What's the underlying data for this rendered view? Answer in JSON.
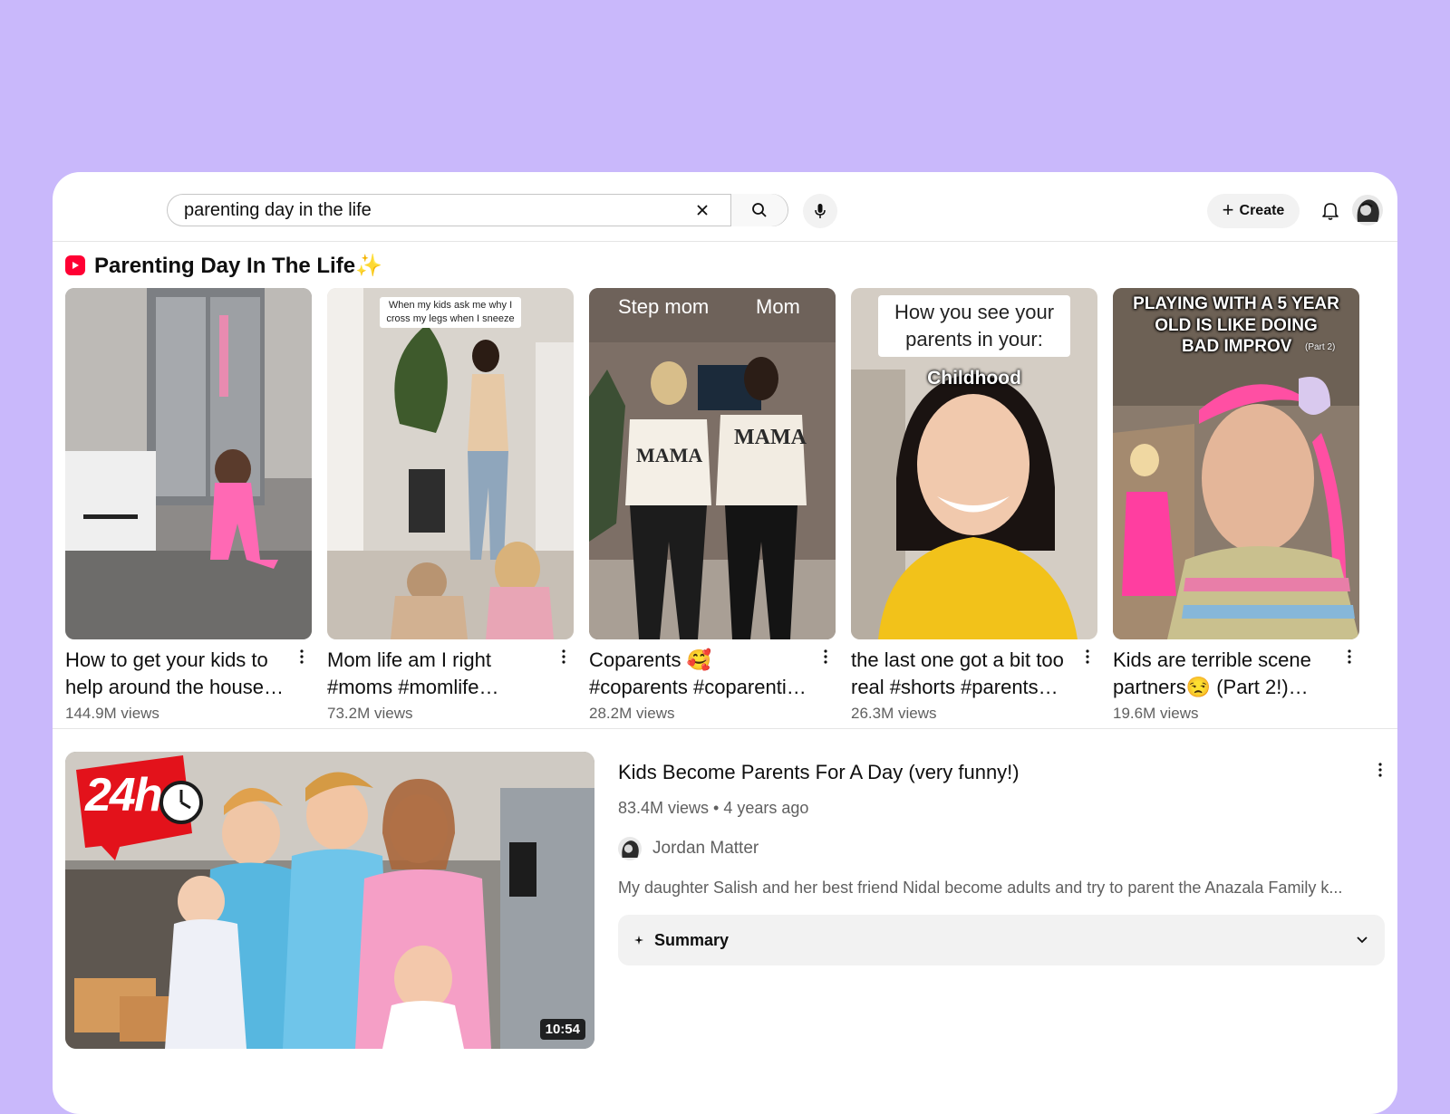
{
  "search": {
    "query": "parenting day in the life"
  },
  "header": {
    "create_label": "Create"
  },
  "shelf": {
    "title": "Parenting Day In The Life✨",
    "shorts": [
      {
        "title": "How to get your kids to help around the house…",
        "views": "144.9M views"
      },
      {
        "title": "Mom life am I right #moms #momlife…",
        "views": "73.2M views",
        "overlay": "When my kids ask me why I cross my legs when I sneeze"
      },
      {
        "title": "Coparents 🥰 #coparents #coparenti…",
        "views": "28.2M views",
        "overlay_left": "Step mom",
        "overlay_right": "Mom",
        "shirt_left": "MAMA",
        "shirt_right": "MAMA"
      },
      {
        "title": "the last one got a bit too real #shorts #parents…",
        "views": "26.3M views",
        "overlay": "How you see your parents in your:",
        "overlay_sub": "Childhood"
      },
      {
        "title": "Kids are terrible scene partners😒  (Part 2!)…",
        "views": "19.6M views",
        "overlay": "PLAYING WITH A 5 YEAR OLD IS LIKE DOING",
        "overlay_sub": "BAD IMPROV",
        "overlay_tag": "(Part 2)"
      }
    ]
  },
  "video": {
    "title": "Kids Become Parents For A Day (very funny!)",
    "meta": "83.4M views • 4 years ago",
    "channel": "Jordan Matter",
    "description": "My daughter Salish and her best friend Nidal become adults and try to parent the Anazala Family k...",
    "duration": "10:54",
    "badge": "24h",
    "summary_label": "Summary"
  },
  "colors": {
    "background": "#c9b8fb",
    "brand_red": "#ff0033"
  }
}
